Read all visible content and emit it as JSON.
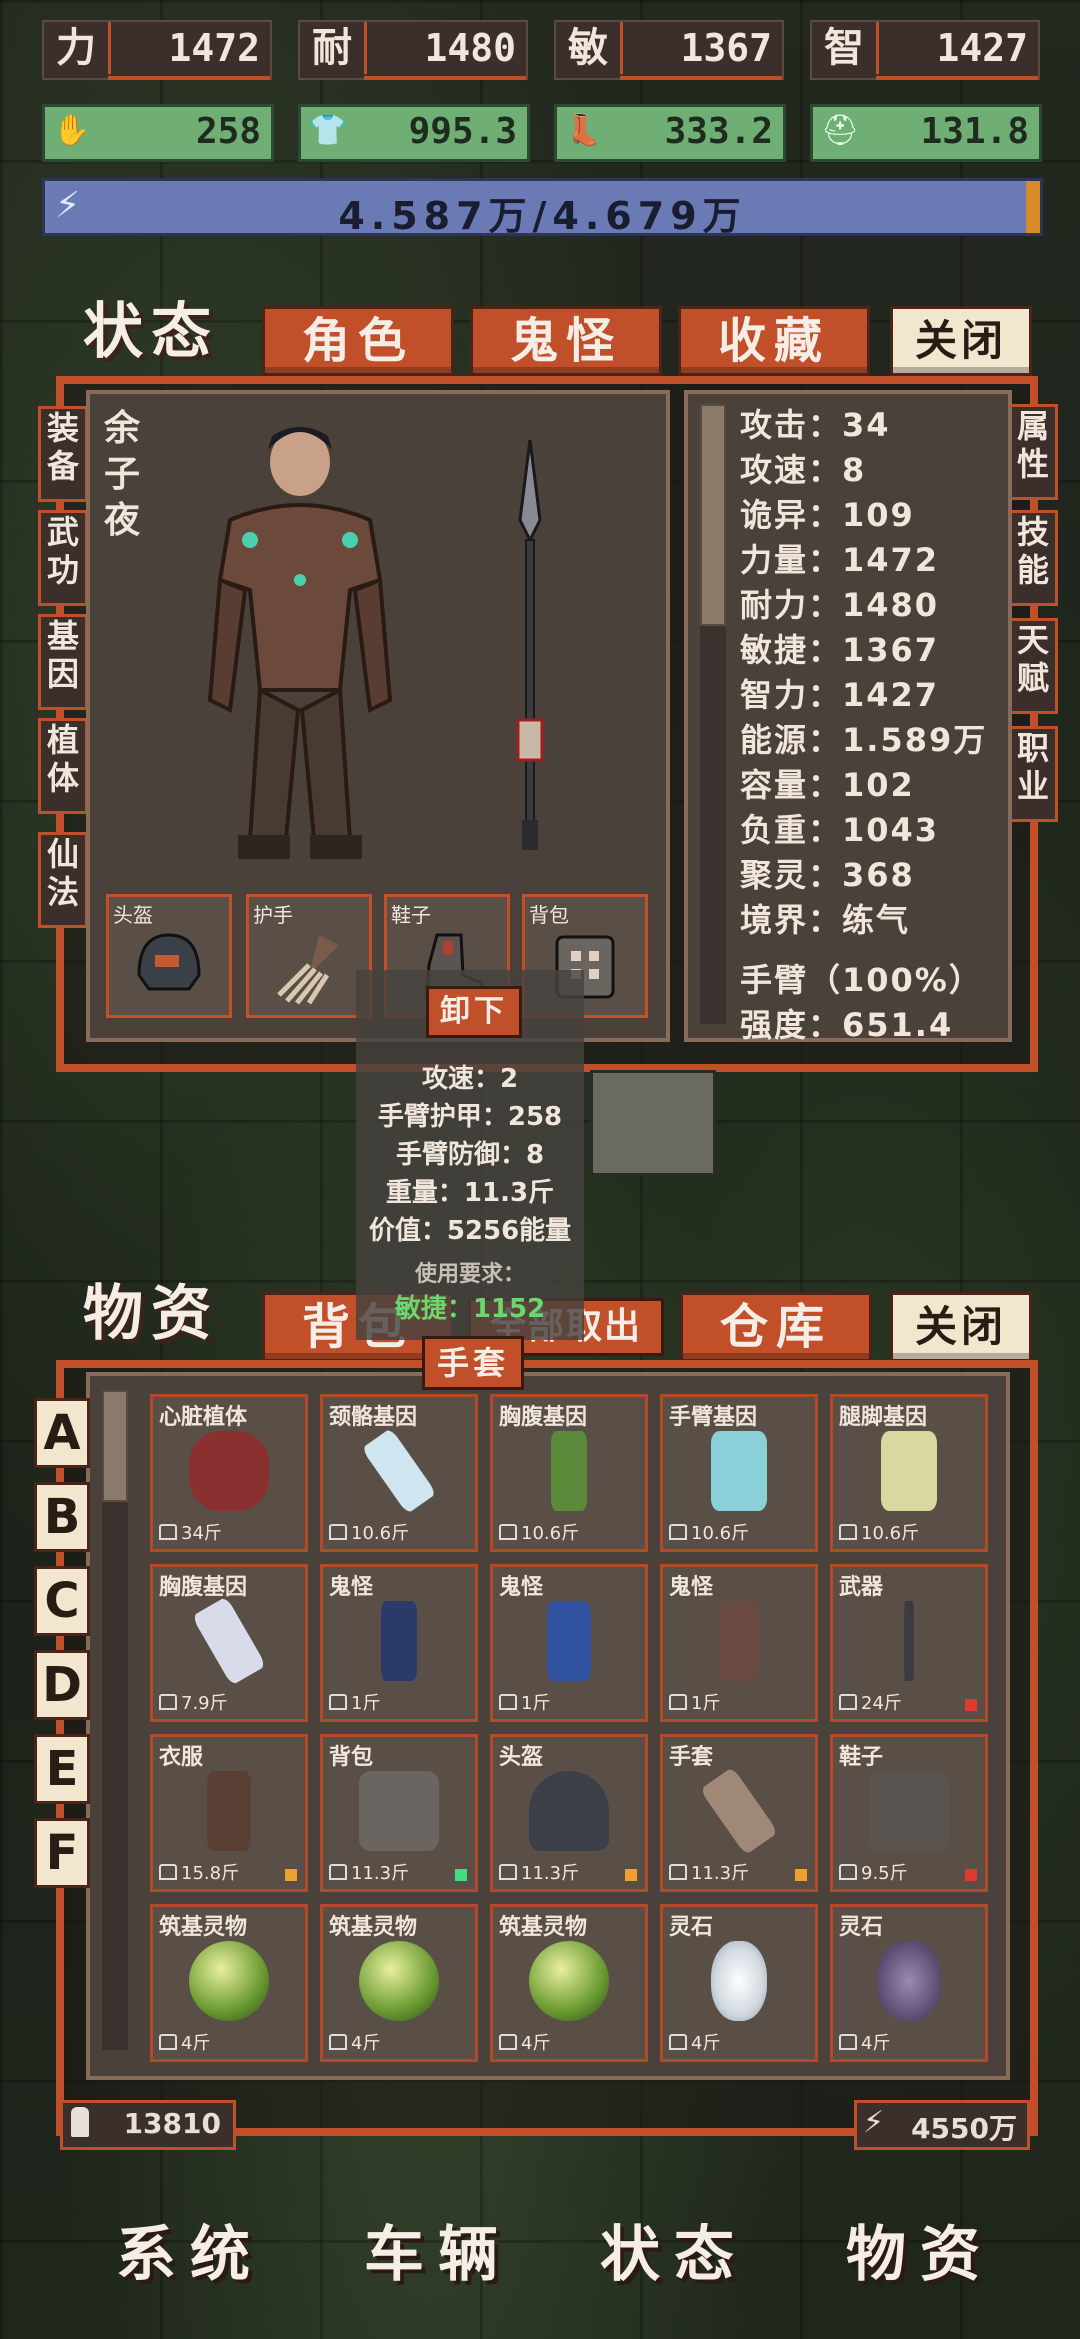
{
  "stats": [
    {
      "label": "力",
      "value": "1472"
    },
    {
      "label": "耐",
      "value": "1480"
    },
    {
      "label": "敏",
      "value": "1367"
    },
    {
      "label": "智",
      "value": "1427"
    }
  ],
  "resources": [
    {
      "icon": "hand-icon",
      "value": "258"
    },
    {
      "icon": "shirt-icon",
      "value": "995.3"
    },
    {
      "icon": "boot-icon",
      "value": "333.2"
    },
    {
      "icon": "helmet-icon",
      "value": "131.8"
    }
  ],
  "energy": {
    "text": "4.587万/4.679万",
    "fraction": 0.98
  },
  "status_tabs": {
    "active": "状态",
    "t1": "角色",
    "t2": "鬼怪",
    "t3": "收藏",
    "close": "关闭"
  },
  "left_side_tabs": [
    "装备",
    "武功",
    "基因",
    "植体",
    "仙法"
  ],
  "right_side_tabs": [
    "属性",
    "技能",
    "天赋",
    "职业"
  ],
  "character": {
    "name": "余子夜"
  },
  "equip_slots": [
    "头盔",
    "护手",
    "鞋子",
    "背包"
  ],
  "attributes": [
    "攻击：34",
    "攻速：8",
    "诡异：109",
    "力量：1472",
    "耐力：1480",
    "敏捷：1367",
    "智力：1427",
    "能源：1.589万",
    "容量：102",
    "负重：1043",
    "聚灵：368",
    "境界：练气",
    "手臂（100%）",
    "强度：651.4"
  ],
  "tooltip": {
    "unload": "卸下",
    "lines": [
      "攻速：2",
      "手臂护甲：258",
      "手臂防御：8",
      "重量：11.3斤",
      "价值：5256能量"
    ],
    "requirement_title": "使用要求：",
    "requirement": "敏捷：1152",
    "item": "手套"
  },
  "goods_tabs": {
    "active": "物资",
    "t1": "背包",
    "take_out": "全部取出",
    "t2": "仓库",
    "close": "关闭"
  },
  "letters": [
    "A",
    "B",
    "C",
    "D",
    "E",
    "F"
  ],
  "items": [
    {
      "name": "心脏植体",
      "weight": "34斤"
    },
    {
      "name": "颈骼基因",
      "weight": "10.6斤"
    },
    {
      "name": "胸腹基因",
      "weight": "10.6斤"
    },
    {
      "name": "手臂基因",
      "weight": "10.6斤"
    },
    {
      "name": "腿脚基因",
      "weight": "10.6斤"
    },
    {
      "name": "胸腹基因",
      "weight": "7.9斤"
    },
    {
      "name": "鬼怪",
      "weight": "1斤"
    },
    {
      "name": "鬼怪",
      "weight": "1斤"
    },
    {
      "name": "鬼怪",
      "weight": "1斤"
    },
    {
      "name": "武器",
      "weight": "24斤"
    },
    {
      "name": "衣服",
      "weight": "15.8斤"
    },
    {
      "name": "背包",
      "weight": "11.3斤"
    },
    {
      "name": "头盔",
      "weight": "11.3斤"
    },
    {
      "name": "手套",
      "weight": "11.3斤"
    },
    {
      "name": "鞋子",
      "weight": "9.5斤"
    },
    {
      "name": "筑基灵物",
      "weight": "4斤"
    },
    {
      "name": "筑基灵物",
      "weight": "4斤"
    },
    {
      "name": "筑基灵物",
      "weight": "4斤"
    },
    {
      "name": "灵石",
      "weight": "4斤"
    },
    {
      "name": "灵石",
      "weight": "4斤"
    }
  ],
  "footer": {
    "left": "13810",
    "right": "4550万"
  },
  "nav": [
    "系统",
    "车辆",
    "状态",
    "物资"
  ],
  "colors": {
    "accent": "#c1502a",
    "green": "#6fae74",
    "energy": "#6a7ab5"
  }
}
